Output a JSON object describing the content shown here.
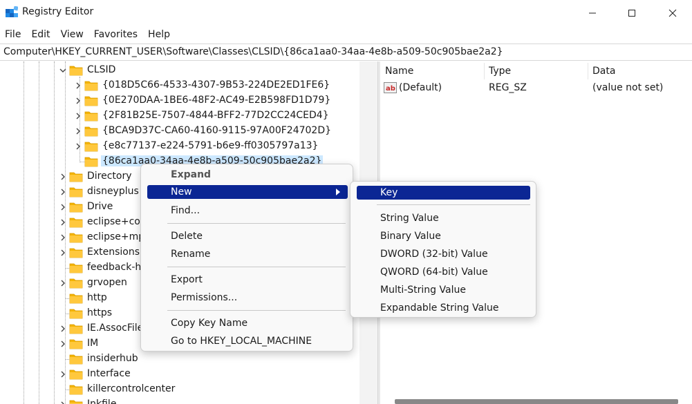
{
  "window": {
    "title": "Registry Editor"
  },
  "menubar": [
    "File",
    "Edit",
    "View",
    "Favorites",
    "Help"
  ],
  "address": "Computer\\HKEY_CURRENT_USER\\Software\\Classes\\CLSID\\{86ca1aa0-34aa-4e8b-a509-50c905bae2a2}",
  "tree": {
    "clsid_label": "CLSID",
    "clsid_children": [
      "{018D5C66-4533-4307-9B53-224DE2ED1FE6}",
      "{0E270DAA-1BE6-48F2-AC49-E2B598FD1D79}",
      "{2F81B25E-7507-4844-BFF2-77D2CC24CED4}",
      "{BCA9D37C-CA60-4160-9115-97A00F24702D}",
      "{e8c77137-e224-5791-b6e9-ff0305797a13}",
      "{86ca1aa0-34aa-4e8b-a509-50c905bae2a2}"
    ],
    "siblings": [
      "Directory",
      "disneyplus",
      "Drive",
      "eclipse+cor",
      "eclipse+mp",
      "Extensions",
      "feedback-h",
      "grvopen",
      "http",
      "https",
      "IE.AssocFile",
      "IM",
      "insiderhub",
      "Interface",
      "killercontrolcenter",
      "Inkfile"
    ]
  },
  "values_pane": {
    "columns": [
      "Name",
      "Type",
      "Data"
    ],
    "rows": [
      {
        "name": "(Default)",
        "type": "REG_SZ",
        "data": "(value not set)"
      }
    ]
  },
  "context_menu": {
    "expand": "Expand",
    "new": "New",
    "find": "Find...",
    "delete": "Delete",
    "rename": "Rename",
    "export": "Export",
    "permissions": "Permissions...",
    "copy_key_name": "Copy Key Name",
    "goto": "Go to HKEY_LOCAL_MACHINE"
  },
  "new_submenu": {
    "key": "Key",
    "items": [
      "String Value",
      "Binary Value",
      "DWORD (32-bit) Value",
      "QWORD (64-bit) Value",
      "Multi-String Value",
      "Expandable String Value"
    ]
  },
  "colors": {
    "highlight": "#0b2694",
    "selection": "#cce8ff",
    "folder": "#f4b400"
  }
}
